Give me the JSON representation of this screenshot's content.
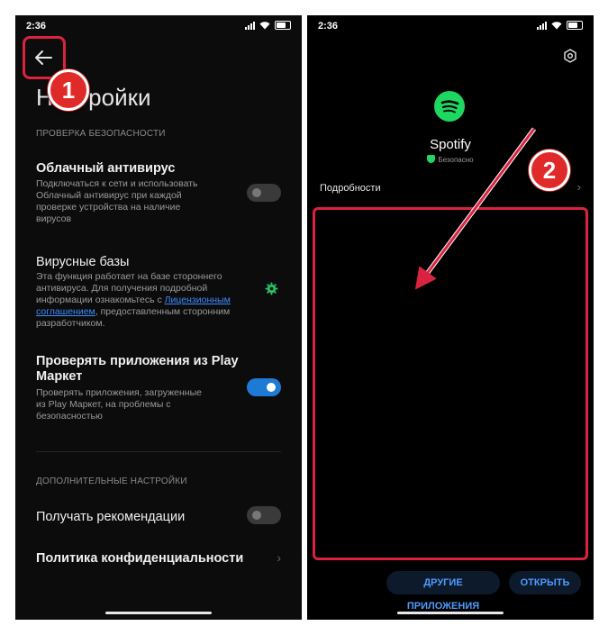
{
  "left_screen": {
    "status": {
      "time": "2:36"
    },
    "page_title": "Настройки",
    "sections": {
      "security_check": "ПРОВЕРКА БЕЗОПАСНОСТИ",
      "additional": "ДОПОЛНИТЕЛЬНЫЕ НАСТРОЙКИ"
    },
    "items": {
      "cloud_antivirus": {
        "title": "Облачный антивирус",
        "desc_1": "Подключаться к сети и использовать",
        "desc_2": "Облачный антивирус при каждой",
        "desc_3": "проверке устройства на наличие",
        "desc_4": "вирусов",
        "enabled": false
      },
      "virus_db": {
        "title": "Вирусные базы",
        "desc_1": "Эта функция работает на базе стороннего",
        "desc_2": "антивируса. Для получения подробной",
        "desc_3a": "информации ознакомьтесь с ",
        "link_1": "Лицензионным",
        "link_2": "соглашением",
        "desc_4": ", предоставленным сторонним",
        "desc_5": "разработчиком."
      },
      "play_check": {
        "title_1": "Проверять приложения из Play",
        "title_2": "Маркет",
        "desc_1": "Проверять приложения, загруженные",
        "desc_2": "из Play Маркет, на проблемы с",
        "desc_3": "безопасностью",
        "enabled": true
      },
      "recommendations": {
        "title": "Получать рекомендации",
        "enabled": false
      },
      "privacy": {
        "title": "Политика конфиденциальности"
      }
    },
    "badge": "1"
  },
  "right_screen": {
    "status": {
      "time": "2:36"
    },
    "app_name": "Spotify",
    "safety_label": "Безопасно",
    "details": "Подробности",
    "buttons": {
      "other_apps": "ДРУГИЕ ПРИЛОЖЕНИЯ",
      "open": "ОТКРЫТЬ"
    },
    "badge": "2"
  },
  "colors": {
    "highlight": "#d9233f",
    "accent_blue": "#1d7bd6",
    "spotify_green": "#1ed760",
    "badge_red": "#e02a2a"
  }
}
